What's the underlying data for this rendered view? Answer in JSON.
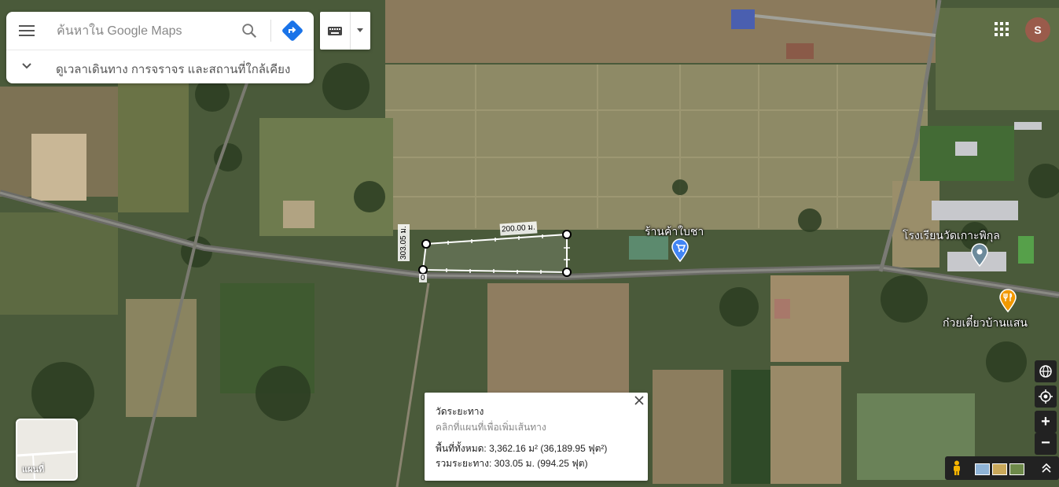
{
  "search": {
    "placeholder": "ค้นหาใน Google Maps",
    "nearby_label": "ดูเวลาเดินทาง การจราจร และสถานที่ใกล้เคียง"
  },
  "icons": {
    "menu": "menu-icon",
    "search": "search-icon",
    "directions": "directions-icon",
    "keyboard": "keyboard-icon",
    "apps": "apps-grid-icon",
    "globe": "globe-icon",
    "locate": "my-location-icon",
    "pegman": "pegman-icon"
  },
  "account": {
    "initial": "S",
    "color": "#9a5b4b"
  },
  "places": [
    {
      "name": "ร้านค้าใบชา",
      "type": "shopping"
    },
    {
      "name": "โรงเรียนวัดเกาะพิกุล",
      "type": "school"
    },
    {
      "name": "ก๋วยเตี๋ยวบ้านแสน",
      "type": "restaurant"
    }
  ],
  "measure": {
    "edge_label_top": "200.00 ม.",
    "edge_label_left": "303.05 ม.",
    "start_marker": "0",
    "card": {
      "title": "วัดระยะทาง",
      "hint": "คลิกที่แผนที่เพื่อเพิ่มเส้นทาง",
      "total_area": "พื้นที่ทั้งหมด: 3,362.16 ม² (36,189.95 ฟุต²)",
      "total_distance": "รวมระยะทาง: 303.05 ม. (994.25 ฟุต)"
    }
  },
  "layer_switcher": {
    "label": "แผนที่"
  },
  "controls": {
    "zoom_in": "+",
    "zoom_out": "−"
  },
  "colors": {
    "accent_blue": "#1a73e8",
    "restaurant_orange": "#f29900",
    "shop_blue": "#4285f4",
    "school_gray": "#6c8a9b"
  }
}
